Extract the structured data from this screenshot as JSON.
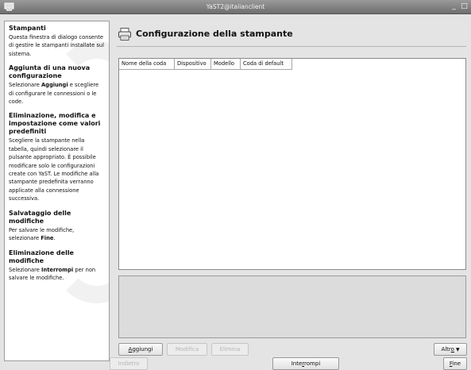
{
  "window": {
    "title": "YaST2@italianclient"
  },
  "help": {
    "sections": [
      {
        "title": "Stampanti",
        "text": "Questa finestra di dialogo consente di gestire le stampanti installate sul sistema."
      },
      {
        "title": "Aggiunta di una nuova configurazione",
        "text_before": "Selezionare ",
        "bold": "Aggiungi",
        "text_after": " e scegliere di configurare le connessioni o le code."
      },
      {
        "title": "Eliminazione, modifica e impostazione come valori predefiniti",
        "text": "Scegliere la stampante nella tabella, quindi selezionare il pulsante appropriato. È possibile modificare solo le configurazioni create con YaST. Le modifiche alla stampante predefinita verranno applicate alla connessione successiva."
      },
      {
        "title": "Salvataggio delle modifiche",
        "text_before": "Per salvare le modifiche, selezionare ",
        "bold": "Fine",
        "text_after": "."
      },
      {
        "title": "Eliminazione delle modifiche",
        "text_before": "Selezionare ",
        "bold": "Interrompi",
        "text_after": " per non salvare le modifiche."
      }
    ]
  },
  "main": {
    "title": "Configurazione della stampante",
    "table": {
      "columns": [
        "Nome della coda",
        "Dispositivo",
        "Modello",
        "Coda di default"
      ],
      "rows": []
    }
  },
  "buttons": {
    "add": {
      "label": "Aggiungi",
      "mnemonic": "A",
      "rest": "ggiungi"
    },
    "edit": {
      "label": "Modifica"
    },
    "delete": {
      "label": "Elimina"
    },
    "other": {
      "label": "Altro",
      "mnemonic": "o",
      "prefix": "Altr",
      "caret": "▼"
    },
    "back": {
      "label": "Indietro"
    },
    "abort": {
      "label": "Interrompi",
      "prefix": "Inte",
      "mnemonic": "r",
      "rest": "rompi"
    },
    "finish": {
      "label": "Fine",
      "mnemonic": "F",
      "rest": "ine"
    }
  }
}
